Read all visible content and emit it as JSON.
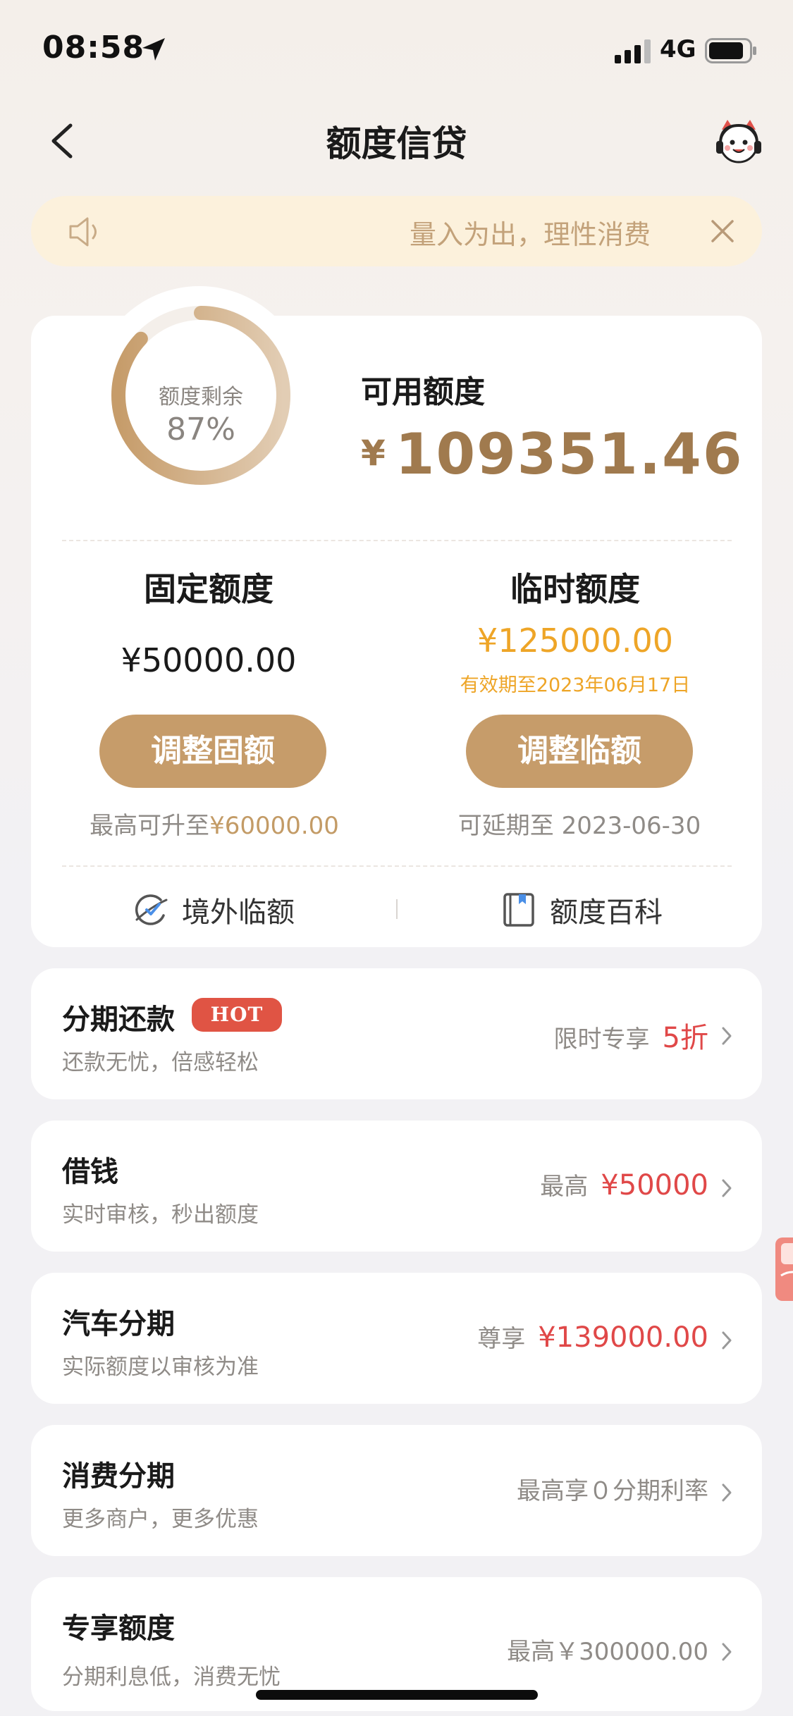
{
  "status_bar": {
    "time": "08:58",
    "network": "4G"
  },
  "nav": {
    "title": "额度信贷"
  },
  "notice": {
    "text": "量入为出，理性消费"
  },
  "credit": {
    "ring_caption": "额度剩余",
    "ring_percent_label": "87%",
    "ring_fraction": 0.87,
    "available_label": "可用额度",
    "available_currency": "¥",
    "available_amount": "109351.46",
    "fixed": {
      "title": "固定额度",
      "amount": "¥50000.00",
      "button": "调整固额",
      "note_prefix": "最高可升至",
      "note_value": "¥60000.00"
    },
    "temporary": {
      "title": "临时额度",
      "amount": "¥125000.00",
      "valid_until": "有效期至2023年06月17日",
      "button": "调整临额",
      "note": "可延期至 2023-06-30"
    },
    "links": {
      "overseas": "境外临额",
      "wiki": "额度百科"
    }
  },
  "services": [
    {
      "title": "分期还款",
      "badge": "HOT",
      "subtitle": "还款无忧，倍感轻松",
      "prefix": "限时专享",
      "value": "5折"
    },
    {
      "title": "借钱",
      "subtitle": "实时审核，秒出额度",
      "prefix": "最高",
      "value": "¥50000"
    },
    {
      "title": "汽车分期",
      "subtitle": "实际额度以审核为准",
      "prefix": "尊享",
      "value": "¥139000.00"
    },
    {
      "title": "消费分期",
      "subtitle": "更多商户，更多优惠",
      "text": "最高享０分期利率"
    },
    {
      "title": "专享额度",
      "subtitle": "分期利息低，消费无忧",
      "text": "最高￥300000.00"
    }
  ],
  "colors": {
    "accent_gold": "#c69c6a",
    "amount_brown": "#a07a4e",
    "temp_orange": "#eea527",
    "promo_red": "#e04848",
    "hot_badge": "#e05444",
    "notice_bg": "#fcf1dc"
  },
  "icons": [
    "location-arrow-icon",
    "signal-icon",
    "battery-icon",
    "back-chevron-icon",
    "customer-service-icon",
    "speaker-icon",
    "close-icon",
    "overseas-icon",
    "book-icon",
    "chevron-right-icon"
  ]
}
